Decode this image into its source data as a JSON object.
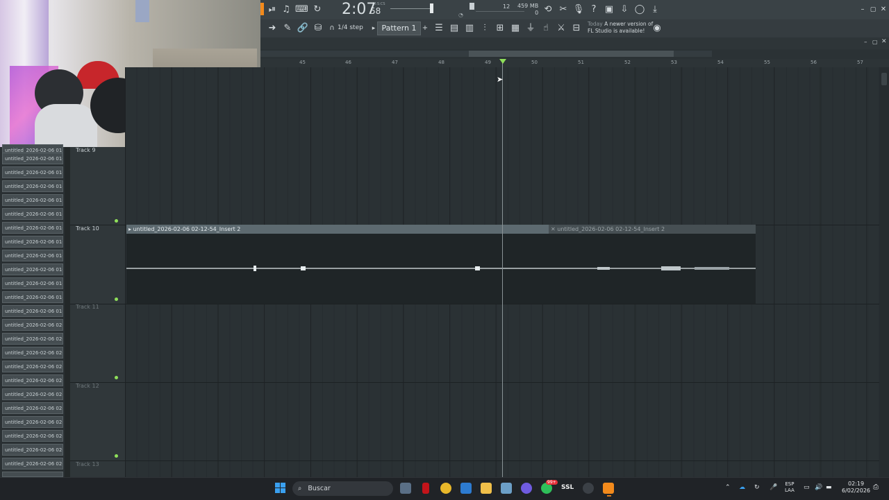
{
  "toolbar": {
    "time_main": "2:07",
    "time_small": "58",
    "time_label": "M:S:CS",
    "cpu": "12",
    "memory": "459 MB",
    "polyphony": "0",
    "snap": "1/4 step",
    "pattern": "Pattern 1",
    "notice_when": "Today",
    "notice_text_1": "A newer version of",
    "notice_text_2": "FL Studio is available!"
  },
  "ruler": {
    "bars": [
      "45",
      "46",
      "47",
      "48",
      "49",
      "50",
      "51",
      "52",
      "53",
      "54",
      "55",
      "56",
      "57"
    ]
  },
  "browser": {
    "files": [
      "untitled_2026-02-06 01-...",
      "untitled_2026-02-06 01-...",
      "untitled_2026-02-06 01-...",
      "untitled_2026-02-06 01-...",
      "untitled_2026-02-06 01-...",
      "untitled_2026-02-06 01-...",
      "untitled_2026-02-06 01-...",
      "untitled_2026-02-06 01-...",
      "untitled_2026-02-06 01-...",
      "untitled_2026-02-06 01-...",
      "untitled_2026-02-06 01-...",
      "untitled_2026-02-06 01-...",
      "untitled_2026-02-06 02-...",
      "untitled_2026-02-06 02-...",
      "untitled_2026-02-06 02-...",
      "untitled_2026-02-06 02-...",
      "untitled_2026-02-06 02-...",
      "untitled_2026-02-06 02-...",
      "untitled_2026-02-06 02-...",
      "untitled_2026-02-06 02-...",
      "untitled_2026-02-06 02-...",
      "untitled_2026-02-06 02-...",
      "untitled_2026-02-06 02-..."
    ]
  },
  "tracks": {
    "t9": "Track 9",
    "t10": "Track 10",
    "t11": "Track 11",
    "t12": "Track 12",
    "t13": "Track 13"
  },
  "clip": {
    "name": "untitled_2026-02-06 02-12-54_Insert 2",
    "name_dim": "untitled_2026-02-06 02-12-54_Insert 2"
  },
  "taskbar": {
    "search": "Buscar",
    "badge": "99+",
    "app_label": "SSL",
    "lang_1": "ESP",
    "lang_2": "LAA",
    "time": "02:19",
    "date": "6/02/2026"
  },
  "colors": {
    "accent_green": "#8fe05a",
    "fl_orange": "#f28a1c"
  }
}
